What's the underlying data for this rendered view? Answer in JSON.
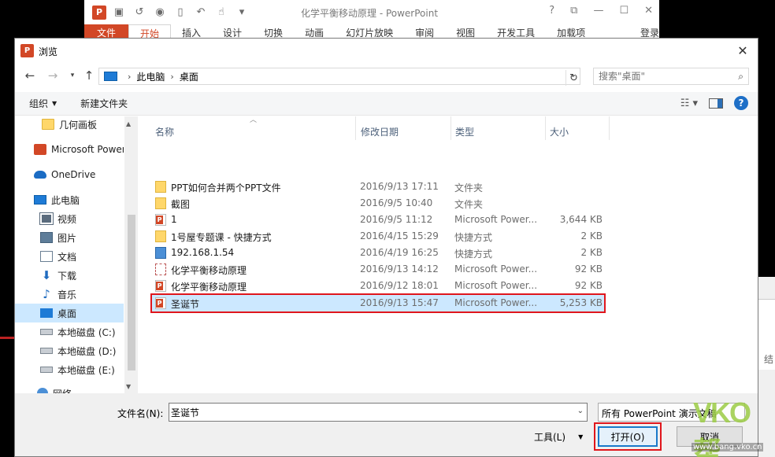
{
  "ppt_window": {
    "title": "化学平衡移动原理 - PowerPoint",
    "logo": "P",
    "tabs": [
      "文件",
      "开始",
      "插入",
      "设计",
      "切换",
      "动画",
      "幻灯片放映",
      "审阅",
      "视图",
      "开发工具",
      "加载项"
    ],
    "login": "登录",
    "window_buttons": [
      "?",
      "⧉",
      "—",
      "☐",
      "✕"
    ],
    "quick_access_icons": [
      "save-icon",
      "redo-icon",
      "present-icon",
      "new-doc-icon",
      "undo-icon",
      "touch-icon",
      "customize-icon"
    ]
  },
  "dialog": {
    "title": "浏览",
    "logo": "P",
    "close": "✕",
    "address": {
      "crumbs": [
        "此电脑",
        "桌面"
      ],
      "separator": "›"
    },
    "search": {
      "placeholder": "搜索\"桌面\""
    },
    "toolbar": {
      "organize": "组织",
      "new_folder": "新建文件夹"
    },
    "nav": [
      {
        "label": "几何画板",
        "icon": "folder-icon"
      },
      {
        "label": "Microsoft Power",
        "icon": "powerpoint-icon"
      },
      {
        "label": "OneDrive",
        "icon": "onedrive-icon"
      },
      {
        "label": "此电脑",
        "icon": "computer-icon"
      },
      {
        "label": "视频",
        "icon": "video-icon"
      },
      {
        "label": "图片",
        "icon": "pictures-icon"
      },
      {
        "label": "文档",
        "icon": "documents-icon"
      },
      {
        "label": "下载",
        "icon": "download-icon"
      },
      {
        "label": "音乐",
        "icon": "music-icon"
      },
      {
        "label": "桌面",
        "icon": "desktop-icon",
        "selected": true
      },
      {
        "label": "本地磁盘 (C:)",
        "icon": "drive-icon"
      },
      {
        "label": "本地磁盘 (D:)",
        "icon": "drive-icon"
      },
      {
        "label": "本地磁盘 (E:)",
        "icon": "drive-icon"
      },
      {
        "label": "网络",
        "icon": "network-icon"
      }
    ],
    "columns": [
      "名称",
      "修改日期",
      "类型",
      "大小"
    ],
    "files": [
      {
        "name": "PPT如何合并两个PPT文件",
        "date": "2016/9/13 17:11",
        "type": "文件夹",
        "size": "",
        "icon": "folder-icon"
      },
      {
        "name": "截图",
        "date": "2016/9/5 10:40",
        "type": "文件夹",
        "size": "",
        "icon": "folder-icon"
      },
      {
        "name": "1",
        "date": "2016/9/5 11:12",
        "type": "Microsoft Power...",
        "size": "3,644 KB",
        "icon": "pptx-file-icon"
      },
      {
        "name": "1号屋专题课 - 快捷方式",
        "date": "2016/4/15 15:29",
        "type": "快捷方式",
        "size": "2 KB",
        "icon": "shortcut-icon"
      },
      {
        "name": "192.168.1.54",
        "date": "2016/4/19 16:25",
        "type": "快捷方式",
        "size": "2 KB",
        "icon": "remote-desktop-icon"
      },
      {
        "name": "化学平衡移动原理",
        "date": "2016/9/13 14:12",
        "type": "Microsoft Power...",
        "size": "92 KB",
        "icon": "pptx-template-icon"
      },
      {
        "name": "化学平衡移动原理",
        "date": "2016/9/12 18:01",
        "type": "Microsoft Power...",
        "size": "92 KB",
        "icon": "pptx-file-icon"
      },
      {
        "name": "圣诞节",
        "date": "2016/9/13 15:47",
        "type": "Microsoft Power...",
        "size": "5,253 KB",
        "icon": "pptx-file-icon",
        "selected": true
      }
    ],
    "filename_label": "文件名(N):",
    "filename_value": "圣诞节",
    "filetype_value": "所有 PowerPoint 演示文稿",
    "tools_label": "工具(L)",
    "open_button": "打开(O)",
    "cancel_button": "取消"
  },
  "background": {
    "right_fragment_text": "结"
  },
  "watermark": {
    "logo": "VKO帮",
    "url": "www.bang.vko.cn"
  },
  "colors": {
    "ppt_brand": "#d24726",
    "selection": "#cce8ff",
    "highlight_box": "#e0161c",
    "accent": "#1979ca"
  }
}
